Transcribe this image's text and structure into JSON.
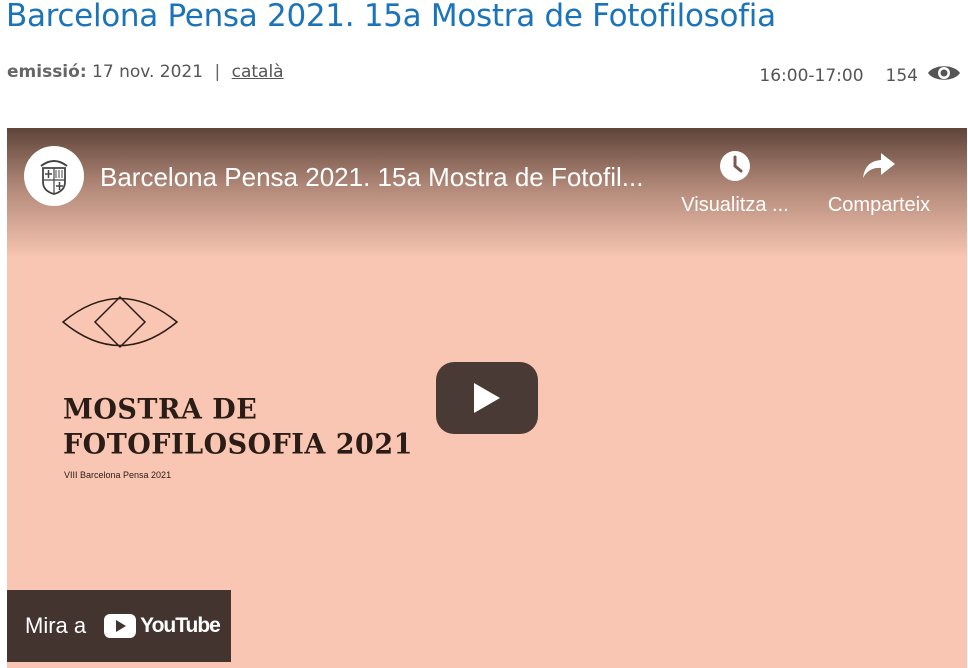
{
  "page": {
    "title": "Barcelona Pensa 2021. 15a Mostra de Fotofilosofia"
  },
  "meta": {
    "emission_label": "emissió:",
    "emission_date": "17 nov. 2021",
    "separator": "|",
    "language": "català",
    "time_range": "16:00-17:00",
    "views": "154",
    "views_icon": "eye-icon"
  },
  "video": {
    "title": "Barcelona Pensa 2021. 15a Mostra de Fotofil...",
    "channel_logo": "barcelona-shield-logo",
    "watch_later_label": "Visualitza ...",
    "share_label": "Comparteix",
    "poster_title_line1": "MOSTRA DE",
    "poster_title_line2": "FOTOFILOSOFIA 2021",
    "poster_subtitle": "VIII Barcelona Pensa 2021",
    "watch_on_label": "Mira a",
    "youtube_label": "YouTube",
    "colors": {
      "background": "#f8c6b2",
      "play_button": "#4a3a35",
      "watch_bar": "#433430",
      "title_link": "#1b74b9"
    }
  }
}
